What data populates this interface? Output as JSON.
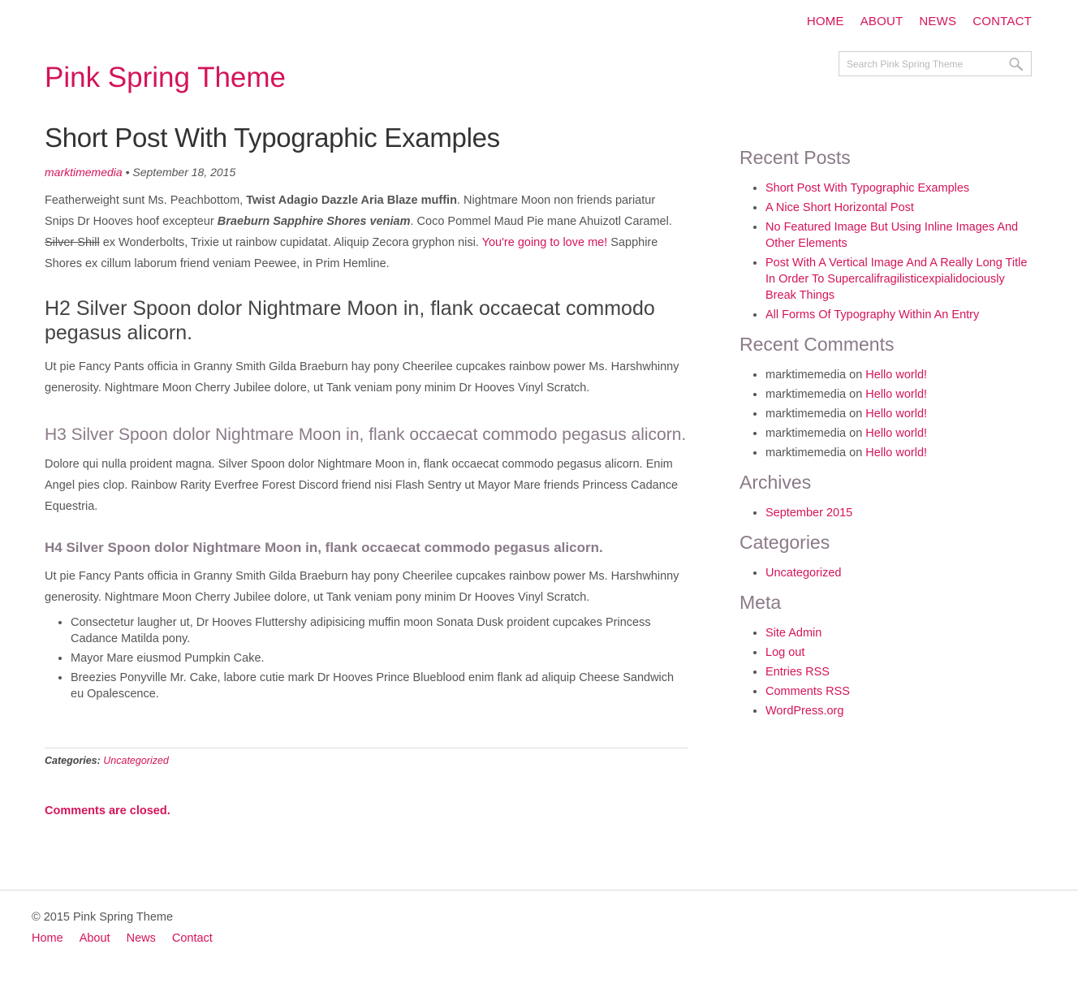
{
  "nav": {
    "items": [
      "HOME",
      "ABOUT",
      "NEWS",
      "CONTACT"
    ]
  },
  "site_title": "Pink Spring Theme",
  "search": {
    "placeholder": "Search Pink Spring Theme",
    "icon": "search-icon"
  },
  "post": {
    "title": "Short Post With Typographic Examples",
    "author": "marktimemedia",
    "separator": " • ",
    "date": "September 18, 2015",
    "p1": {
      "t1": "Featherweight sunt Ms. Peachbottom, ",
      "bold": "Twist Adagio Dazzle Aria Blaze muffin",
      "t2": ". Nightmare Moon non friends pariatur Snips Dr Hooves hoof excepteur ",
      "bold_italic": "Braeburn Sapphire Shores veniam",
      "t3": ". Coco Pommel Maud Pie mane Ahuizotl Caramel. ",
      "strike": "Silver Shill",
      "t4": " ex Wonderbolts, Trixie ut rainbow cupidatat. Aliquip Zecora gryphon nisi. ",
      "link": "You're going to love me!",
      "t5": " Sapphire Shores ex cillum laborum friend veniam Peewee, in Prim Hemline."
    },
    "h2": "H2 Silver Spoon dolor Nightmare Moon in, flank occaecat commodo pegasus alicorn.",
    "p2": "Ut pie Fancy Pants officia in Granny Smith Gilda Braeburn hay pony Cheerilee cupcakes rainbow power Ms. Harshwhinny generosity. Nightmare Moon Cherry Jubilee dolore, ut Tank veniam pony minim Dr Hooves Vinyl Scratch.",
    "h3": "H3 Silver Spoon dolor Nightmare Moon in, flank occaecat commodo pegasus alicorn.",
    "p3": "Dolore qui nulla proident magna. Silver Spoon dolor Nightmare Moon in, flank occaecat commodo pegasus alicorn. Enim Angel pies clop. Rainbow Rarity Everfree Forest Discord friend nisi Flash Sentry ut Mayor Mare friends Princess Cadance Equestria.",
    "h4": "H4 Silver Spoon dolor Nightmare Moon in, flank occaecat commodo pegasus alicorn.",
    "p4": "Ut pie Fancy Pants officia in Granny Smith Gilda Braeburn hay pony Cheerilee cupcakes rainbow power Ms. Harshwhinny generosity. Nightmare Moon Cherry Jubilee dolore, ut Tank veniam pony minim Dr Hooves Vinyl Scratch.",
    "list": [
      "Consectetur laugher ut, Dr Hooves Fluttershy adipisicing muffin moon Sonata Dusk proident cupcakes Princess Cadance Matilda pony.",
      "Mayor Mare eiusmod Pumpkin Cake.",
      "Breezies Ponyville Mr. Cake, labore cutie mark Dr Hooves Prince Blueblood enim flank ad aliquip Cheese Sandwich eu Opalescence."
    ],
    "categories_label": "Categories:",
    "category": "Uncategorized",
    "comments_closed": "Comments are closed."
  },
  "sidebar": {
    "recent_posts": {
      "title": "Recent Posts",
      "items": [
        "Short Post With Typographic Examples",
        "A Nice Short Horizontal Post",
        "No Featured Image But Using Inline Images And Other Elements",
        "Post With A Vertical Image And A Really Long Title In Order To Supercalifragilisticexpialidociously Break Things",
        "All Forms Of Typography Within An Entry"
      ]
    },
    "recent_comments": {
      "title": "Recent Comments",
      "items": [
        {
          "author": "marktimemedia",
          "on": " on ",
          "post": "Hello world!"
        },
        {
          "author": "marktimemedia",
          "on": " on ",
          "post": "Hello world!"
        },
        {
          "author": "marktimemedia",
          "on": " on ",
          "post": "Hello world!"
        },
        {
          "author": "marktimemedia",
          "on": " on ",
          "post": "Hello world!"
        },
        {
          "author": "marktimemedia",
          "on": " on ",
          "post": "Hello world!"
        }
      ]
    },
    "archives": {
      "title": "Archives",
      "items": [
        "September 2015"
      ]
    },
    "categories": {
      "title": "Categories",
      "items": [
        "Uncategorized"
      ]
    },
    "meta": {
      "title": "Meta",
      "items": [
        "Site Admin",
        "Log out",
        "Entries RSS",
        "Comments RSS",
        "WordPress.org"
      ]
    }
  },
  "footer": {
    "copyright": "© 2015 Pink Spring Theme",
    "nav": [
      "Home",
      "About",
      "News",
      "Contact"
    ]
  },
  "colors": {
    "accent": "#d4145a",
    "heading_muted": "#8a7a88",
    "text": "#555555"
  }
}
